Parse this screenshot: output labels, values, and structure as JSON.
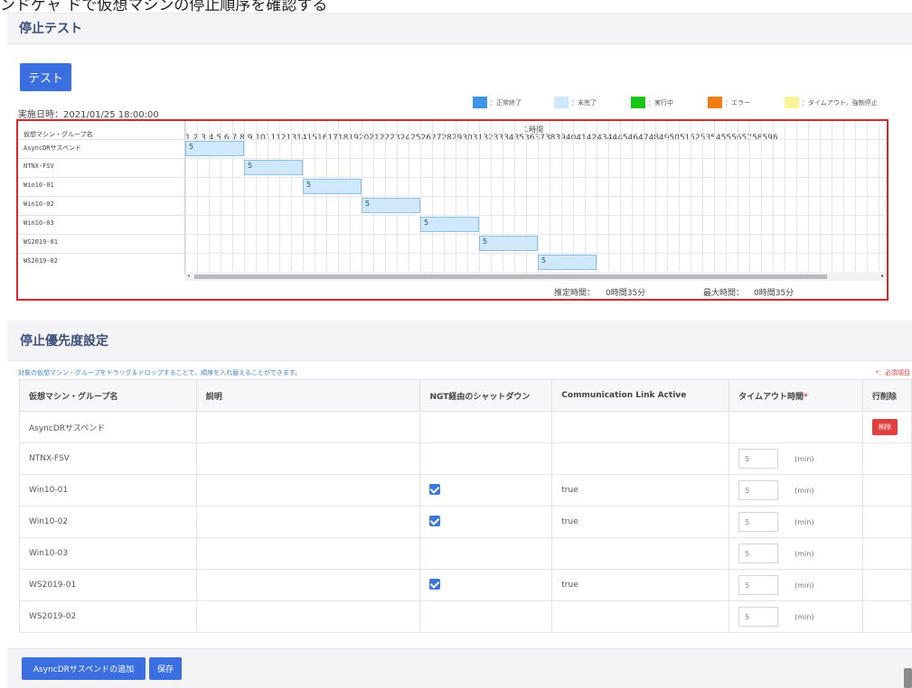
{
  "page_caption": "ンドゲャ ドで仮想マシンの停止順序を確認する",
  "stop_test": {
    "title": "停止テスト",
    "test_button": "テスト",
    "exec_date": "実施日時：2021/01/25 18:00:00",
    "legend": [
      {
        "label": "：正常終了",
        "color": "#3d96e8"
      },
      {
        "label": "：未完了",
        "color": "#cfe8fb"
      },
      {
        "label": "：実行中",
        "color": "#18c418"
      },
      {
        "label": "：エラー",
        "color": "#f07c12"
      },
      {
        "label": "：タイムアウト、強制停止",
        "color": "#fbf59a"
      }
    ],
    "gantt": {
      "header": "仮想マシン・グループ名",
      "timeline_title": "1時間",
      "minutes": "1 2 3 4 5 6 7 8 9 10111213141516171819202122232425262728293031323334353637383940414243444546474849505152535455565758596",
      "rows": [
        {
          "name": "AsyncDRサスペンド",
          "label": "5",
          "start_min": 0,
          "duration_min": 5
        },
        {
          "name": "NTNX-FSV",
          "label": "5",
          "start_min": 5,
          "duration_min": 5
        },
        {
          "name": "Win10-01",
          "label": "5",
          "start_min": 10,
          "duration_min": 5
        },
        {
          "name": "Win10-02",
          "label": "5",
          "start_min": 15,
          "duration_min": 5
        },
        {
          "name": "Win10-03",
          "label": "5",
          "start_min": 20,
          "duration_min": 5
        },
        {
          "name": "WS2019-01",
          "label": "5",
          "start_min": 25,
          "duration_min": 5
        },
        {
          "name": "WS2019-02",
          "label": "5",
          "start_min": 30,
          "duration_min": 5
        }
      ],
      "scroll_left": "◂",
      "scroll_right": "▸",
      "estimated_label": "推定時間：",
      "estimated_value": "0時間35分",
      "max_label": "最大時間：",
      "max_value": "0時間35分"
    }
  },
  "priority": {
    "title": "停止優先度設定",
    "hint": "対象の仮想マシン・グループをドラッグ＆ドロップすることで、順序を入れ替えることができます。",
    "required_note": "*：必須項目",
    "columns": {
      "name": "仮想マシン・グループ名",
      "description": "説明",
      "ngt_shutdown": "NGT経由のシャットダウン",
      "comm_link": "Communication Link Active",
      "timeout": "タイムアウト時間",
      "timeout_required": "*",
      "delete": "行削除"
    },
    "delete_label": "削除",
    "unit": "(min)",
    "rows": [
      {
        "name": "AsyncDRサスペンド",
        "description": "",
        "ngt": false,
        "comm": "",
        "timeout": ""
      },
      {
        "name": "NTNX-FSV",
        "description": "",
        "ngt": false,
        "comm": "",
        "timeout": "5"
      },
      {
        "name": "Win10-01",
        "description": "",
        "ngt": true,
        "comm": "true",
        "timeout": "5"
      },
      {
        "name": "Win10-02",
        "description": "",
        "ngt": true,
        "comm": "true",
        "timeout": "5"
      },
      {
        "name": "Win10-03",
        "description": "",
        "ngt": false,
        "comm": "",
        "timeout": "5"
      },
      {
        "name": "WS2019-01",
        "description": "",
        "ngt": true,
        "comm": "true",
        "timeout": "5"
      },
      {
        "name": "WS2019-02",
        "description": "",
        "ngt": false,
        "comm": "",
        "timeout": "5"
      }
    ]
  },
  "footer": {
    "add_button": "AsyncDRサスペンドの追加",
    "save_button": "保存"
  }
}
